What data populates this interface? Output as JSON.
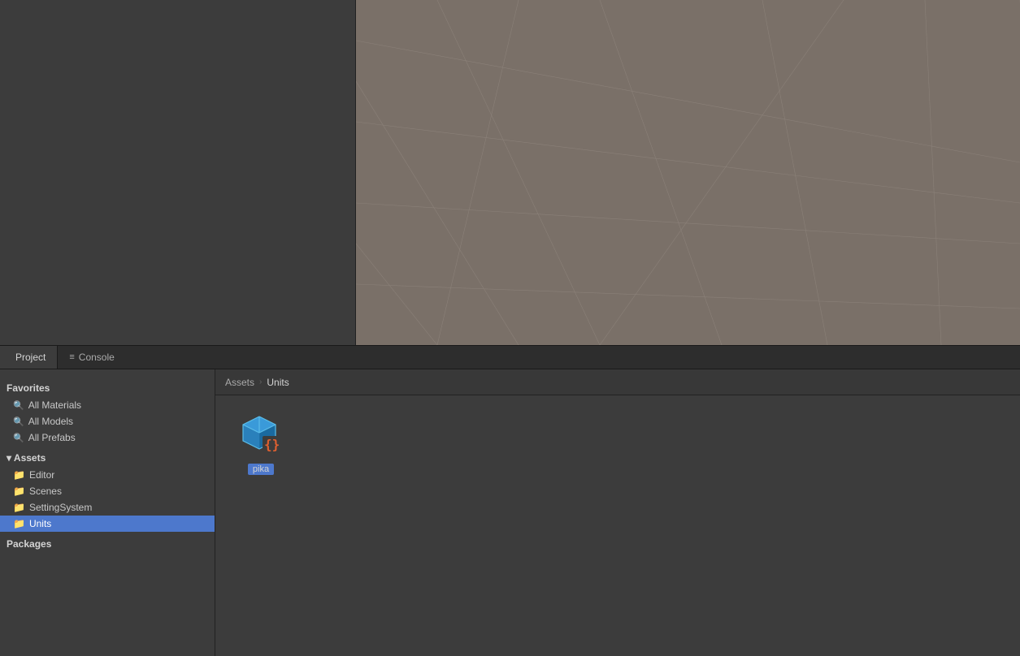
{
  "top_section": {
    "left_panel_bg": "#3c3c3c",
    "scene_bg": "#7a7068"
  },
  "tabs": [
    {
      "id": "project",
      "label": "Project",
      "icon": "",
      "active": true
    },
    {
      "id": "console",
      "label": "Console",
      "icon": "≡",
      "active": false
    }
  ],
  "sidebar": {
    "favorites_header": "Favorites",
    "favorites_items": [
      {
        "id": "all-materials",
        "label": "All Materials",
        "icon": "🔍"
      },
      {
        "id": "all-models",
        "label": "All Models",
        "icon": "🔍"
      },
      {
        "id": "all-prefabs",
        "label": "All Prefabs",
        "icon": "🔍"
      }
    ],
    "assets_header": "Assets",
    "assets_items": [
      {
        "id": "editor",
        "label": "Editor",
        "icon": "📁",
        "selected": false
      },
      {
        "id": "scenes",
        "label": "Scenes",
        "icon": "📁",
        "selected": false
      },
      {
        "id": "setting-system",
        "label": "SettingSystem",
        "icon": "📁",
        "selected": false
      },
      {
        "id": "units",
        "label": "Units",
        "icon": "📁",
        "selected": true
      }
    ],
    "packages_header": "Packages"
  },
  "breadcrumb": {
    "items": [
      {
        "label": "Assets",
        "current": false
      },
      {
        "label": "Units",
        "current": true
      }
    ],
    "separator": "›"
  },
  "assets_grid": {
    "items": [
      {
        "id": "pika",
        "label": "pika",
        "type": "prefab"
      }
    ]
  },
  "colors": {
    "accent_blue": "#4d78cc",
    "prefab_blue": "#3a9ad9",
    "script_orange": "#e06030",
    "bg_dark": "#3c3c3c",
    "bg_darker": "#2d2d2d",
    "scene_bg": "#7a7068",
    "text_primary": "#d4d4d4",
    "text_secondary": "#aaa",
    "selected_bg": "#4d78cc",
    "grid_line": "#8a8078"
  }
}
